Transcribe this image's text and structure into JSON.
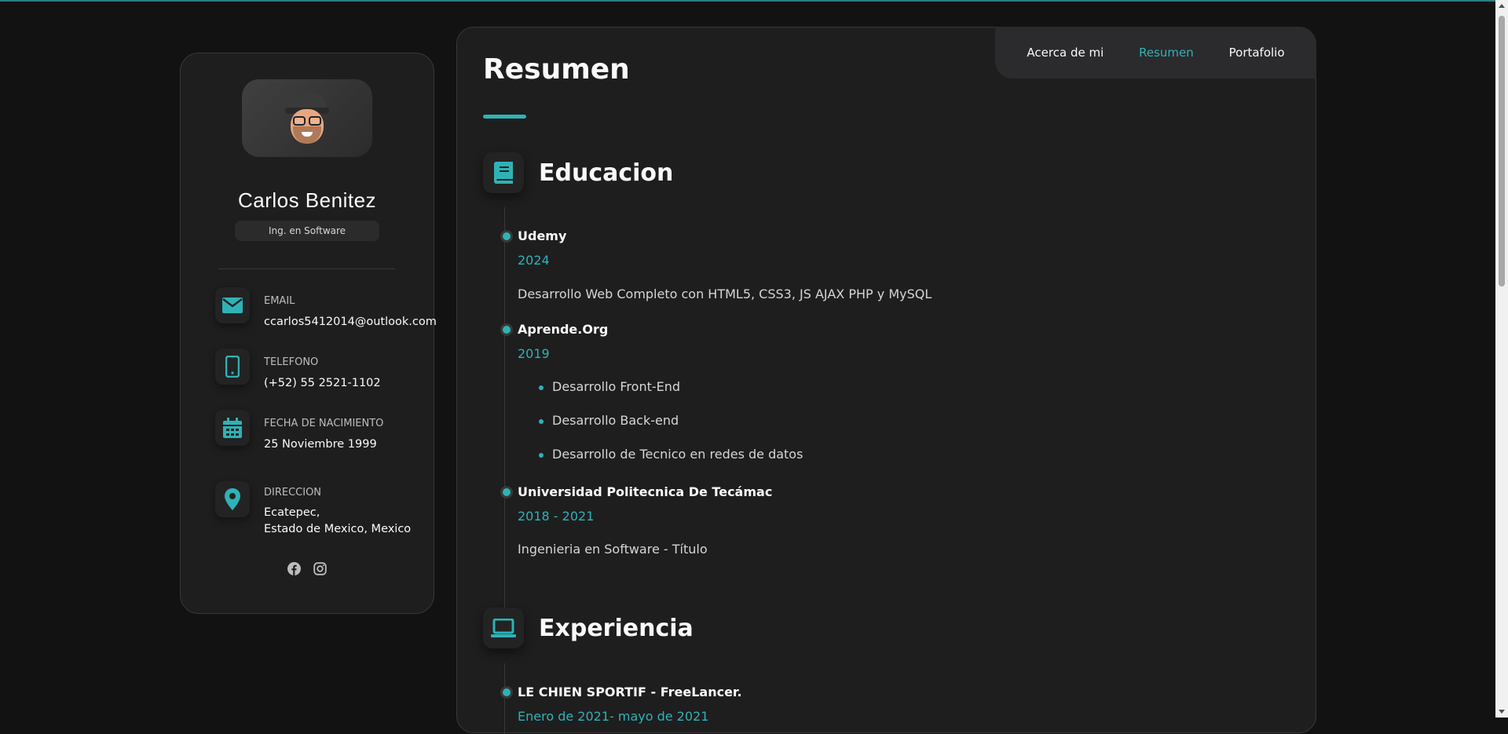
{
  "profile": {
    "name": "Carlos Benitez",
    "title": "Ing. en Software"
  },
  "contacts": [
    {
      "label": "EMAIL",
      "value": "ccarlos5412014@outlook.com",
      "icon": "envelope-icon"
    },
    {
      "label": "TELEFONO",
      "value": "(+52) 55 2521-1102",
      "icon": "phone-icon"
    },
    {
      "label": "FECHA DE NACIMIENTO",
      "value": "25 Noviembre 1999",
      "icon": "calendar-icon"
    },
    {
      "label": "DIRECCION",
      "value_line1": "Ecatepec,",
      "value_line2": "Estado de Mexico, Mexico",
      "icon": "location-pin-icon"
    }
  ],
  "socials": [
    "facebook-icon",
    "instagram-icon"
  ],
  "navbar": {
    "items": [
      {
        "label": "Acerca de mi",
        "active": false
      },
      {
        "label": "Resumen",
        "active": true
      },
      {
        "label": "Portafolio",
        "active": false
      }
    ]
  },
  "page": {
    "title": "Resumen"
  },
  "education": {
    "heading": "Educacion",
    "icon": "book-icon",
    "items": [
      {
        "title": "Udemy",
        "date": "2024",
        "text": "Desarrollo Web Completo con HTML5, CSS3, JS AJAX PHP y MySQL"
      },
      {
        "title": "Aprende.Org",
        "date": "2019",
        "bullets": [
          "Desarrollo Front-End",
          "Desarrollo Back-end",
          "Desarrollo de Tecnico en redes de datos"
        ]
      },
      {
        "title": "Universidad Politecnica De Tecámac",
        "date": "2018 - 2021",
        "text": "Ingenieria en Software - Título"
      }
    ]
  },
  "experience": {
    "heading": "Experiencia",
    "icon": "laptop-icon",
    "items": [
      {
        "title": "LE CHIEN SPORTIF - FreeLancer.",
        "date": "Enero de 2021- mayo de 2021"
      }
    ]
  },
  "colors": {
    "accent": "#2fb2b6",
    "background": "#121212",
    "card": "#1e1e1f",
    "border": "#383838"
  }
}
